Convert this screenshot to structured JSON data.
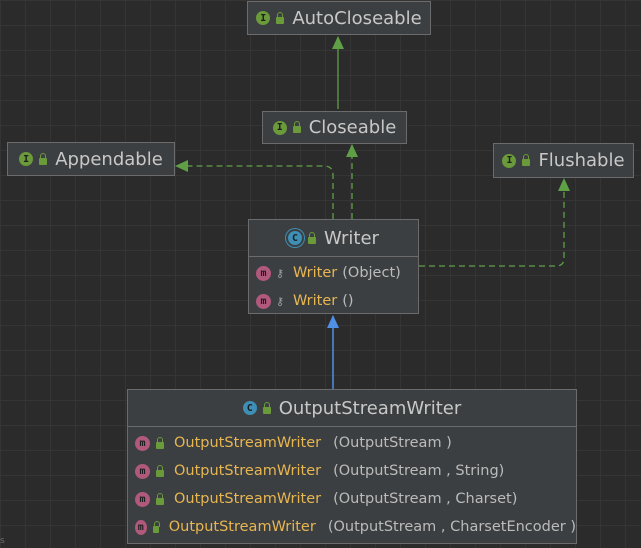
{
  "nodes": {
    "autocloseable": {
      "kind": "I",
      "name": "AutoCloseable"
    },
    "closeable": {
      "kind": "I",
      "name": "Closeable"
    },
    "appendable": {
      "kind": "I",
      "name": "Appendable"
    },
    "flushable": {
      "kind": "I",
      "name": "Flushable"
    },
    "writer": {
      "kind": "C",
      "name": "Writer",
      "methods": [
        {
          "icon": "m",
          "name": "Writer",
          "params": "(Object)"
        },
        {
          "icon": "m",
          "name": "Writer",
          "params": "()"
        }
      ]
    },
    "outputstreamwriter": {
      "kind": "C",
      "name": "OutputStreamWriter",
      "methods": [
        {
          "icon": "m",
          "name": "OutputStreamWriter",
          "params": "(OutputStream )"
        },
        {
          "icon": "m",
          "name": "OutputStreamWriter",
          "params": "(OutputStream , String)"
        },
        {
          "icon": "m",
          "name": "OutputStreamWriter",
          "params": "(OutputStream , Charset)"
        },
        {
          "icon": "m",
          "name": "OutputStreamWriter",
          "params": "(OutputStream , CharsetEncoder )"
        }
      ]
    }
  },
  "colors": {
    "interface_extends": "#5fa046",
    "class_extends": "#4f8fe6",
    "method_name": "#e8b651"
  },
  "corner_mark": "s"
}
